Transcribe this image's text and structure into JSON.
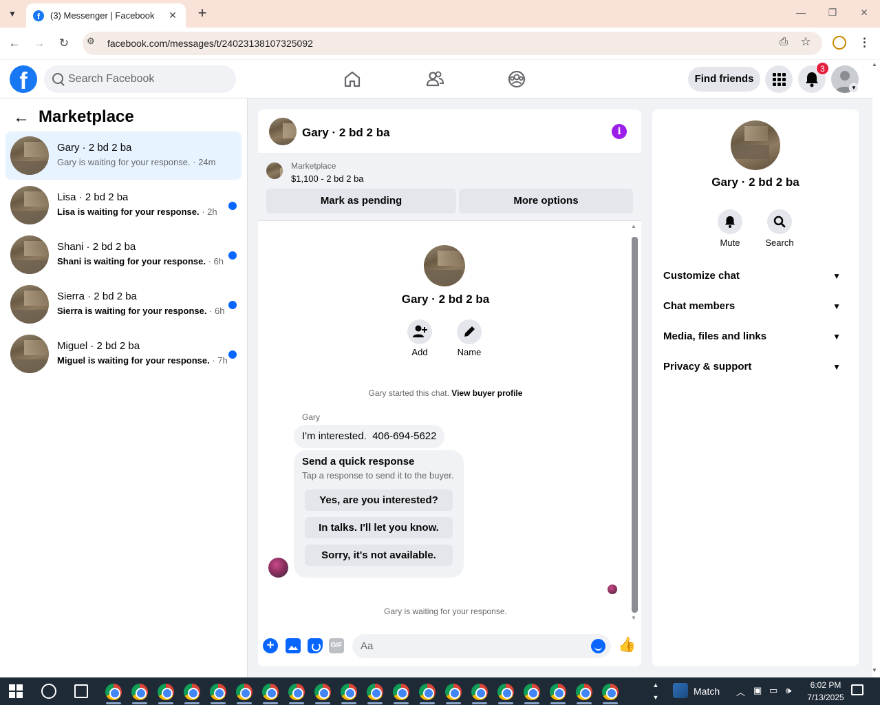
{
  "browser": {
    "tab_title": "(3) Messenger | Facebook",
    "url": "facebook.com/messages/t/24023138107325092",
    "tab_list_icon": "chevron-down-icon",
    "new_tab_symbol": "+",
    "close_symbol": "✕"
  },
  "fb_header": {
    "logo": "f",
    "search_placeholder": "Search Facebook",
    "find_friends_label": "Find friends",
    "notification_count": "3"
  },
  "sidebar": {
    "title": "Marketplace",
    "conversations": [
      {
        "name": "Gary · 2 bd 2 ba",
        "preview": "Gary is waiting for your response.",
        "time": " · 24m",
        "active": true,
        "unread": false
      },
      {
        "name": "Lisa · 2 bd 2 ba",
        "preview": "Lisa is waiting for your response.",
        "time": " · 2h",
        "active": false,
        "unread": true
      },
      {
        "name": "Shani · 2 bd 2 ba",
        "preview": "Shani is waiting for your response.",
        "time": " · 6h",
        "active": false,
        "unread": true
      },
      {
        "name": "Sierra · 2 bd 2 ba",
        "preview": "Sierra is waiting for your response.",
        "time": " · 6h",
        "active": false,
        "unread": true
      },
      {
        "name": "Miguel · 2 bd 2 ba",
        "preview": "Miguel is waiting for your response.",
        "time": " · 7h",
        "active": false,
        "unread": true
      }
    ]
  },
  "chat": {
    "title": "Gary · 2 bd 2 ba",
    "listing": {
      "label": "Marketplace",
      "price_title": "$1,100 - 2 bd 2 ba",
      "mark_pending_label": "Mark as pending",
      "more_options_label": "More options"
    },
    "intro": {
      "name": "Gary · 2 bd 2 ba",
      "add_label": "Add",
      "name_label": "Name"
    },
    "started_text": "Gary started this chat.",
    "view_profile_link": "View buyer profile",
    "sender": "Gary",
    "message": "I'm interested.  406-694-5622",
    "quick_response": {
      "title": "Send a quick response",
      "subtitle": "Tap a response to send it to the buyer.",
      "options": [
        "Yes, are you interested?",
        "In talks. I'll let you know.",
        "Sorry, it's not available."
      ]
    },
    "waiting_text": "Gary is waiting for your response.",
    "composer_placeholder": "Aa",
    "gif_label": "GIF"
  },
  "right_panel": {
    "name": "Gary · 2 bd 2 ba",
    "mute_label": "Mute",
    "search_label": "Search",
    "sections": [
      "Customize chat",
      "Chat members",
      "Media, files and links",
      "Privacy & support"
    ]
  },
  "taskbar": {
    "weather_label": "Match",
    "time": "6:02 PM",
    "date": "7/13/2025",
    "app_count": 20
  },
  "colors": {
    "accent": "#0866ff",
    "fb_blue": "#1877f2",
    "info_purple": "#9b1fe8",
    "badge_red": "#e41e3f",
    "active_row": "#e7f3ff"
  }
}
